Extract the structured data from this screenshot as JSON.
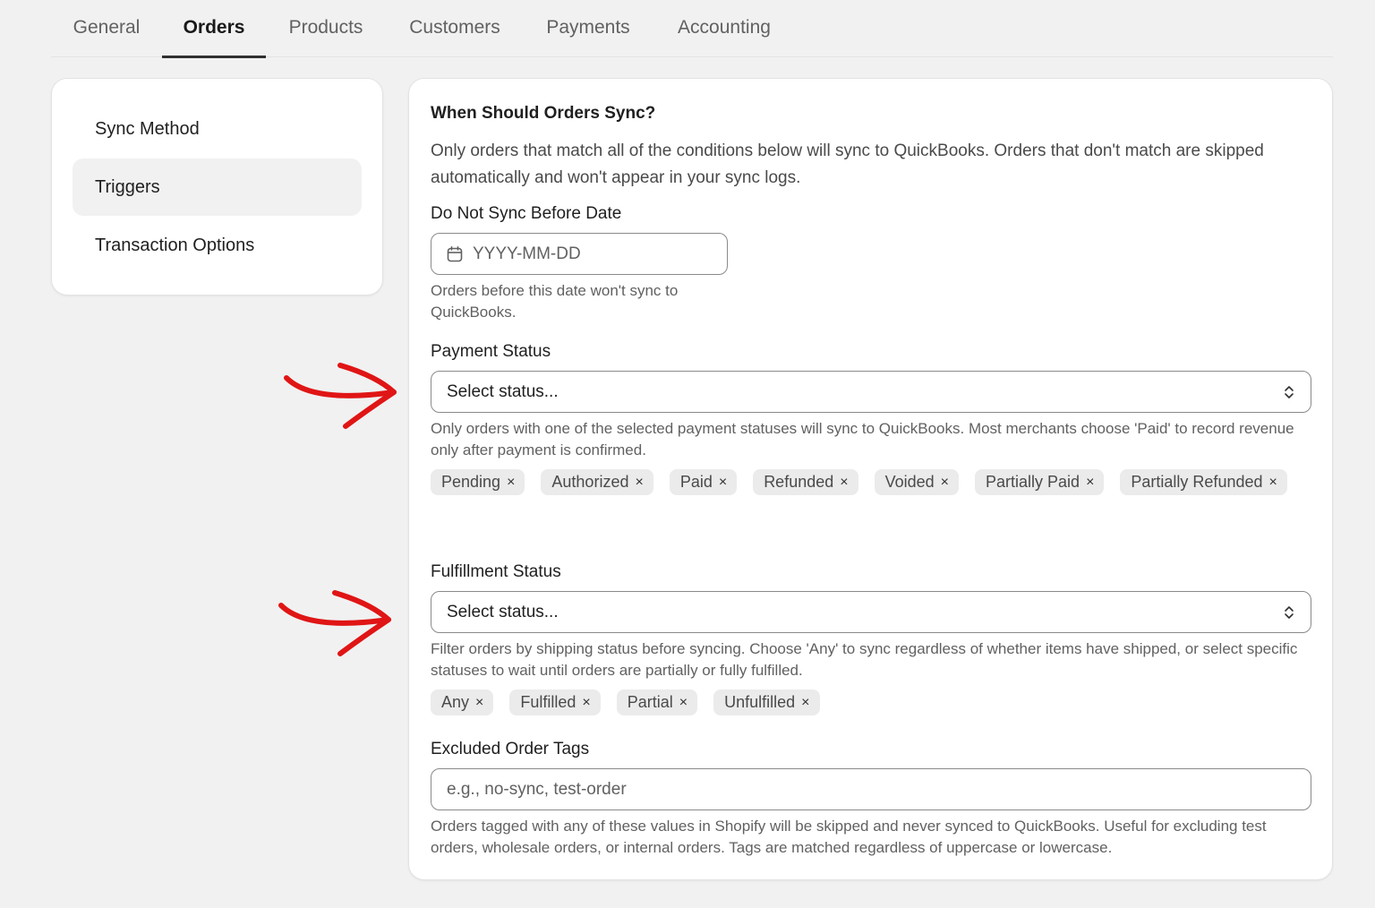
{
  "tabs": [
    {
      "label": "General"
    },
    {
      "label": "Orders"
    },
    {
      "label": "Products"
    },
    {
      "label": "Customers"
    },
    {
      "label": "Payments"
    },
    {
      "label": "Accounting"
    }
  ],
  "active_tab": "Orders",
  "sidebar": {
    "items": [
      {
        "label": "Sync Method"
      },
      {
        "label": "Triggers"
      },
      {
        "label": "Transaction Options"
      }
    ],
    "selected": "Triggers"
  },
  "main": {
    "title": "When Should Orders Sync?",
    "description": "Only orders that match all of the conditions below will sync to QuickBooks. Orders that don't match are skipped automatically and won't appear in your sync logs.",
    "date_section": {
      "label": "Do Not Sync Before Date",
      "placeholder": "YYYY-MM-DD",
      "help": "Orders before this date won't sync to QuickBooks."
    },
    "payment_section": {
      "label": "Payment Status",
      "select_value": "Select status...",
      "help": "Only orders with one of the selected payment statuses will sync to QuickBooks. Most merchants choose 'Paid' to record revenue only after payment is confirmed.",
      "chips": [
        "Pending",
        "Authorized",
        "Paid",
        "Refunded",
        "Voided",
        "Partially Paid",
        "Partially Refunded"
      ]
    },
    "fulfillment_section": {
      "label": "Fulfillment Status",
      "select_value": "Select status...",
      "help": "Filter orders by shipping status before syncing. Choose 'Any' to sync regardless of whether items have shipped, or select specific statuses to wait until orders are partially or fully fulfilled.",
      "chips": [
        "Any",
        "Fulfilled",
        "Partial",
        "Unfulfilled"
      ]
    },
    "tags_section": {
      "label": "Excluded Order Tags",
      "placeholder": "e.g., no-sync, test-order",
      "help": "Orders tagged with any of these values in Shopify will be skipped and never synced to QuickBooks. Useful for excluding test orders, wholesale orders, or internal orders. Tags are matched regardless of uppercase or lowercase."
    },
    "chip_remove_glyph": "×"
  },
  "icons": {
    "calendar": "calendar-icon",
    "select_chevron": "chevron-up-down-icon",
    "annotation_arrow": "red-arrow-icon"
  },
  "colors": {
    "page_bg": "#f1f1f1",
    "card_bg": "#ffffff",
    "chip_bg": "#ebebeb",
    "annotation": "#e01515"
  }
}
